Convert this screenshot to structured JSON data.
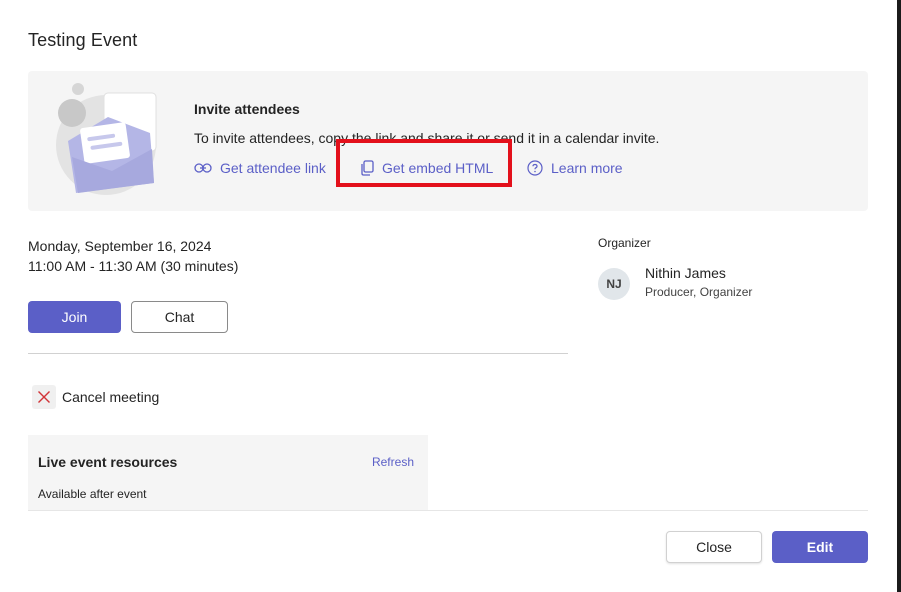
{
  "dialog": {
    "title": "Testing Event"
  },
  "invite": {
    "heading": "Invite attendees",
    "description": "To invite attendees, copy the link and share it or send it in a calendar invite.",
    "links": [
      {
        "label": "Get attendee link",
        "icon": "link-icon"
      },
      {
        "label": "Get embed HTML",
        "icon": "copy-icon"
      },
      {
        "label": "Learn more",
        "icon": "help-circle-icon"
      }
    ]
  },
  "meeting": {
    "date": "Monday, September 16, 2024",
    "time": "11:00 AM - 11:30 AM (30 minutes)",
    "join_label": "Join",
    "chat_label": "Chat",
    "cancel_label": "Cancel meeting"
  },
  "resources": {
    "title": "Live event resources",
    "refresh_label": "Refresh",
    "subtitle": "Available after event"
  },
  "organizer": {
    "label": "Organizer",
    "initials": "NJ",
    "name": "Nithin James",
    "role": "Producer, Organizer"
  },
  "footer": {
    "close_label": "Close",
    "edit_label": "Edit"
  },
  "colors": {
    "accent": "#5b5fc7",
    "highlight": "#e3101b",
    "cancel": "#d13438"
  }
}
